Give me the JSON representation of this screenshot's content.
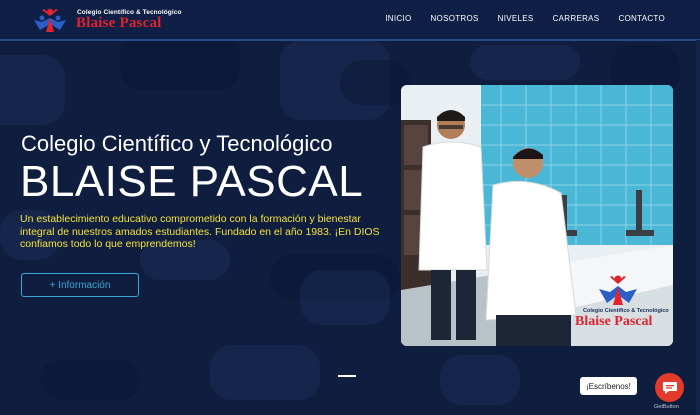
{
  "brand": {
    "small": "Colegio Científico & Tecnológico",
    "big": "Blaise Pascal"
  },
  "nav": [
    "INICIO",
    "NOSOTROS",
    "NIVELES",
    "CARRERAS",
    "CONTACTO"
  ],
  "hero": {
    "title": "Colegio Científico y Tecnológico",
    "big_title": "BLAISE PASCAL",
    "description": "Un establecimiento educativo comprometido con la formación y bienestar integral de nuestros amados estudiantes. Fundado en el año 1983. ¡En DIOS confiamos todo lo que emprendemos!",
    "button": "+ Información"
  },
  "photo_logo": {
    "small": "Colegio Científico & Tecnológico",
    "big": "Blaise Pascal"
  },
  "chat": {
    "label": "¡Escríbenos!",
    "footer": "GetButton"
  },
  "colors": {
    "background": "#0f1d3e",
    "accent_yellow": "#f5e23a",
    "accent_blue": "#39a7d8",
    "brand_red": "#e0242e"
  }
}
